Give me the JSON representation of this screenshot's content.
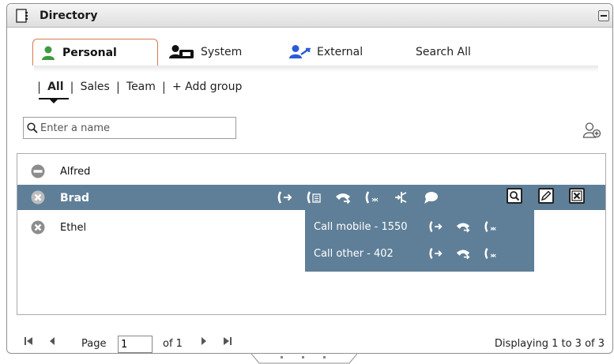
{
  "window": {
    "title": "Directory",
    "title_icon": "address-book-icon",
    "minimize_icon": "minimize-icon"
  },
  "tabs": [
    {
      "label": "Personal",
      "icon": "person-icon",
      "active": true
    },
    {
      "label": "System",
      "icon": "system-contacts-icon",
      "active": false
    },
    {
      "label": "External",
      "icon": "external-contacts-icon",
      "active": false
    },
    {
      "label": "Search All",
      "active": false
    }
  ],
  "groups": {
    "items": [
      "All",
      "Sales",
      "Team"
    ],
    "add_label": "Add group",
    "active": "All"
  },
  "search": {
    "placeholder": "Enter a name",
    "value": "",
    "icon": "search-icon"
  },
  "contacts": [
    {
      "name": "Alfred",
      "status": "do-not-disturb",
      "selected": false
    },
    {
      "name": "Brad",
      "status": "offline",
      "selected": true
    },
    {
      "name": "Ethel",
      "status": "offline",
      "selected": false
    }
  ],
  "selected_actions": [
    "call-icon",
    "voicemail-icon",
    "transfer-icon",
    "call-other-icon",
    "conference-icon",
    "chat-icon",
    "view-icon",
    "edit-icon",
    "delete-icon"
  ],
  "popup": {
    "items": [
      {
        "label": "Call mobile - 1550"
      },
      {
        "label": "Call other - 402"
      }
    ]
  },
  "pager": {
    "page_label": "Page",
    "page_value": "1",
    "of_label": "of 1",
    "display_label": "Displaying 1 to 3 of 3"
  },
  "colors": {
    "selection": "#5f7f98",
    "accent_tab_border": "#d97a4f",
    "person_green": "#3f9a3f",
    "external_blue": "#2a5bd7"
  }
}
